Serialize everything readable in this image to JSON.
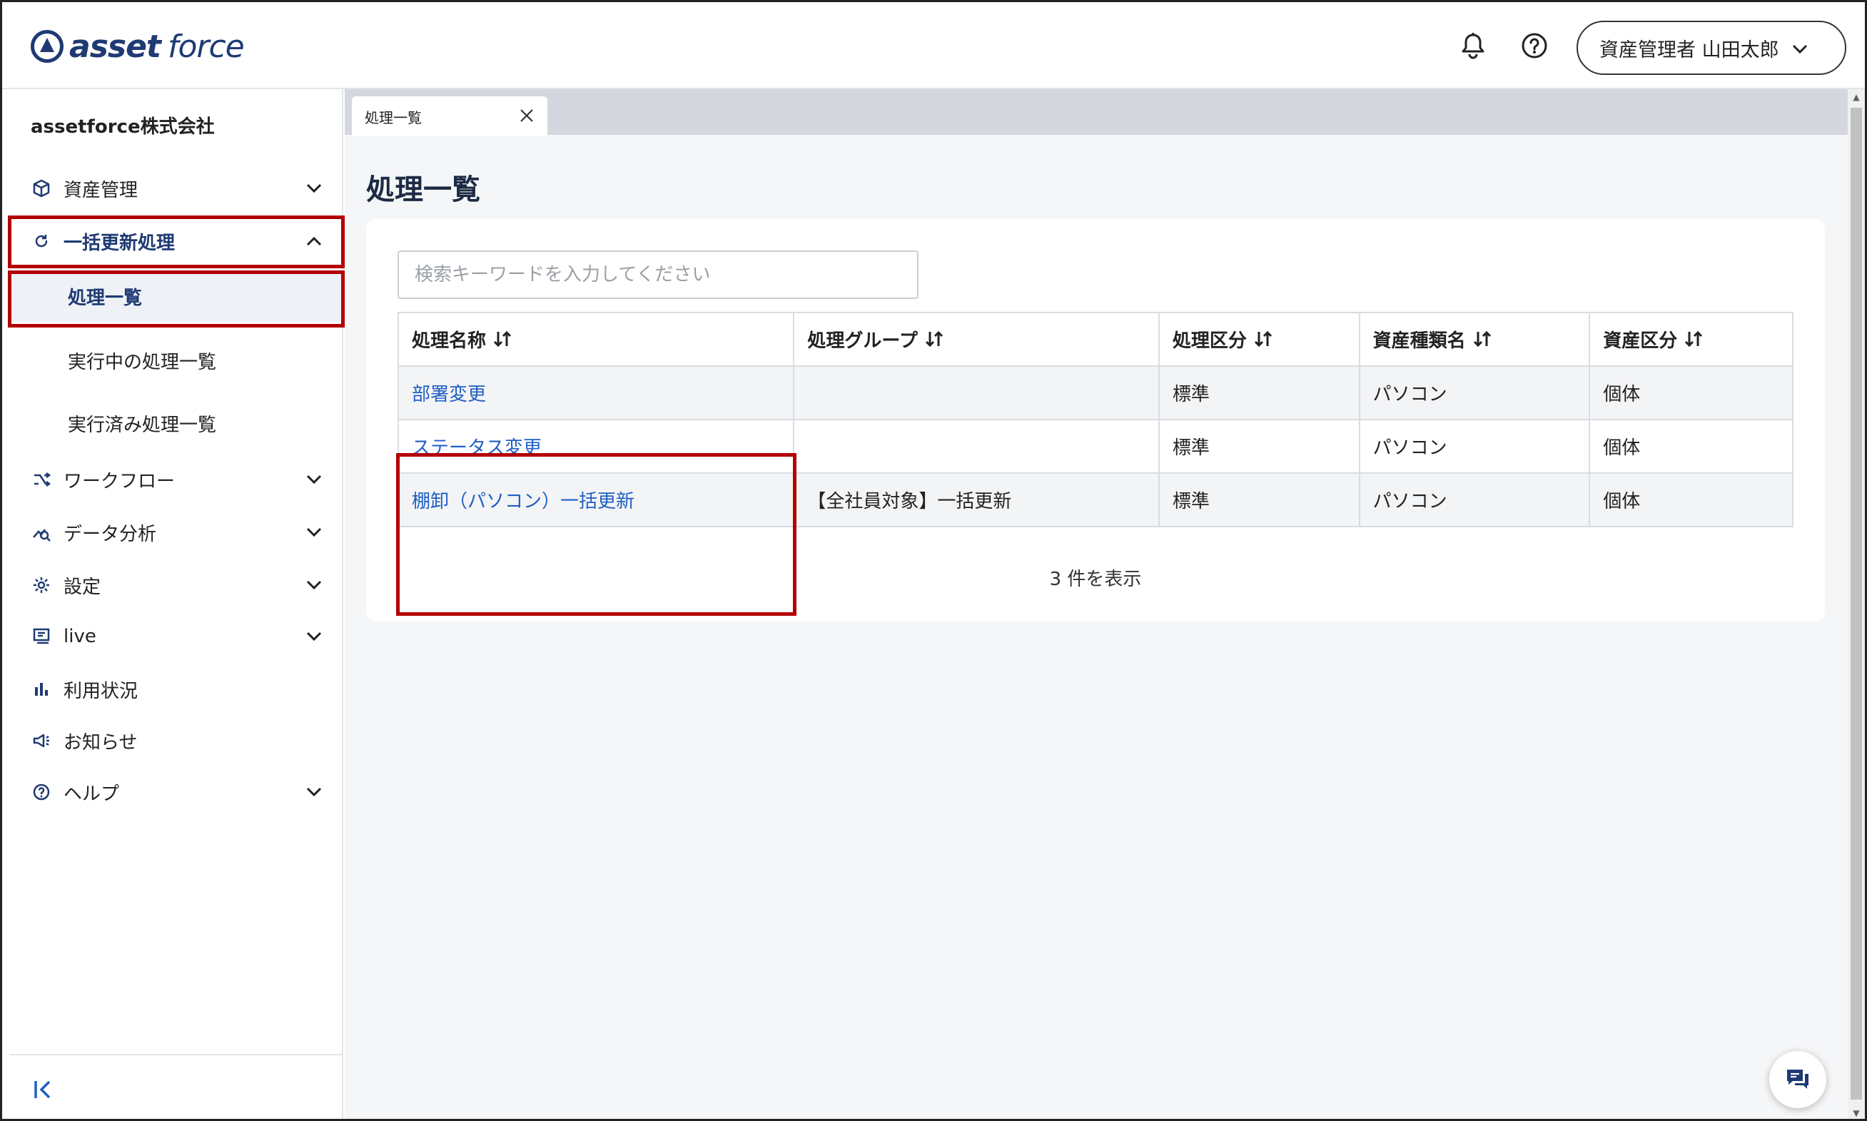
{
  "header": {
    "logo_bold": "asset",
    "logo_light": "force",
    "user_menu_label": "資産管理者 山田太郎"
  },
  "sidebar": {
    "org_name": "assetforce株式会社",
    "items": [
      {
        "label": "資産管理",
        "icon": "cube-icon"
      },
      {
        "label": "一括更新処理",
        "icon": "refresh-icon"
      },
      {
        "label": "ワークフロー",
        "icon": "workflow-icon"
      },
      {
        "label": "データ分析",
        "icon": "analytics-icon"
      },
      {
        "label": "設定",
        "icon": "gear-icon"
      },
      {
        "label": "live",
        "icon": "live-icon"
      },
      {
        "label": "利用状況",
        "icon": "bar-chart-icon"
      },
      {
        "label": "お知らせ",
        "icon": "megaphone-icon"
      },
      {
        "label": "ヘルプ",
        "icon": "help-circle-icon"
      }
    ],
    "sub_items": [
      {
        "label": "処理一覧"
      },
      {
        "label": "実行中の処理一覧"
      },
      {
        "label": "実行済み処理一覧"
      }
    ]
  },
  "tabs": [
    {
      "label": "処理一覧"
    }
  ],
  "main": {
    "title": "処理一覧",
    "search_placeholder": "検索キーワードを入力してください",
    "columns": [
      "処理名称",
      "処理グループ",
      "処理区分",
      "資産種類名",
      "資産区分"
    ],
    "rows": [
      {
        "name": "部署変更",
        "group": "",
        "type": "標準",
        "asset_type": "パソコン",
        "asset_class": "個体"
      },
      {
        "name": "ステータス変更",
        "group": "",
        "type": "標準",
        "asset_type": "パソコン",
        "asset_class": "個体"
      },
      {
        "name": "棚卸（パソコン）一括更新",
        "group": "【全社員対象】一括更新",
        "type": "標準",
        "asset_type": "パソコン",
        "asset_class": "個体"
      }
    ],
    "count_text": "3 件を表示"
  },
  "colors": {
    "brand": "#1f3a73",
    "link": "#1f5fc4",
    "highlight_box": "#b30000"
  }
}
